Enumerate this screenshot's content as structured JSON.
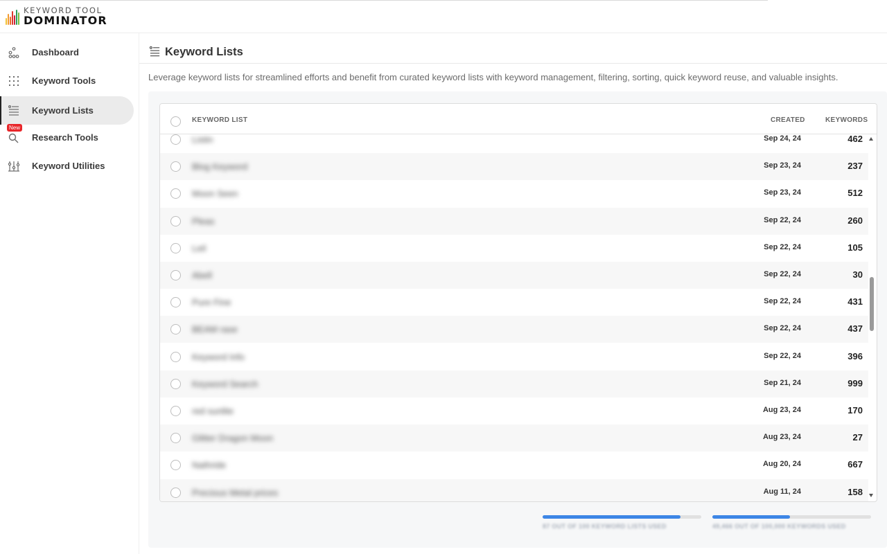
{
  "brand": {
    "top": "KEYWORD TOOL",
    "bottom": "DOMINATOR",
    "bar_colors": [
      "#f2c233",
      "#f29a2e",
      "#e86a2c",
      "#e0392b",
      "#c9223f",
      "#2d9d5c",
      "#7bbd3e"
    ]
  },
  "sidebar": {
    "items": [
      {
        "label": "Dashboard",
        "icon": "dashboard-nodes-icon",
        "active": false
      },
      {
        "label": "Keyword Tools",
        "icon": "grid-dots-icon",
        "active": false
      },
      {
        "label": "Keyword Lists",
        "icon": "list-lines-icon",
        "active": true
      },
      {
        "label": "Research Tools",
        "icon": "magnifier-icon",
        "active": false,
        "badge": "New"
      },
      {
        "label": "Keyword Utilities",
        "icon": "sliders-icon",
        "active": false
      }
    ]
  },
  "page": {
    "title": "Keyword Lists",
    "description": "Leverage keyword lists for streamlined efforts and benefit from curated keyword lists with keyword management, filtering, sorting, quick keyword reuse, and valuable insights."
  },
  "table": {
    "columns": {
      "list": "KEYWORD LIST",
      "created": "CREATED",
      "keywords": "KEYWORDS"
    },
    "rows": [
      {
        "name": "Listin",
        "created": "Sep 24, 24",
        "keywords": "462"
      },
      {
        "name": "Blog Keyword",
        "created": "Sep 23, 24",
        "keywords": "237"
      },
      {
        "name": "Moon Seen",
        "created": "Sep 23, 24",
        "keywords": "512"
      },
      {
        "name": "Pleas",
        "created": "Sep 22, 24",
        "keywords": "260"
      },
      {
        "name": "Leil",
        "created": "Sep 22, 24",
        "keywords": "105"
      },
      {
        "name": "Abell",
        "created": "Sep 22, 24",
        "keywords": "30"
      },
      {
        "name": "Pure Fine",
        "created": "Sep 22, 24",
        "keywords": "431"
      },
      {
        "name": "BEAM rase",
        "created": "Sep 22, 24",
        "keywords": "437"
      },
      {
        "name": "Keyword Info",
        "created": "Sep 22, 24",
        "keywords": "396"
      },
      {
        "name": "Keyword Search",
        "created": "Sep 21, 24",
        "keywords": "999"
      },
      {
        "name": "red sunlite",
        "created": "Aug 23, 24",
        "keywords": "170"
      },
      {
        "name": "Glitter Dragon Moon",
        "created": "Aug 23, 24",
        "keywords": "27"
      },
      {
        "name": "Nathride",
        "created": "Aug 20, 24",
        "keywords": "667"
      },
      {
        "name": "Precious Metal prices",
        "created": "Aug 11, 24",
        "keywords": "158"
      }
    ]
  },
  "usage": {
    "lists": {
      "text": "87 OUT OF 100 KEYWORD LISTS USED",
      "fraction": 0.87
    },
    "keywords": {
      "text": "49,466 OUT OF 100,000 KEYWORDS USED",
      "fraction": 0.49
    }
  },
  "colors": {
    "accent": "#3d86e6",
    "badge": "#e8262a"
  }
}
